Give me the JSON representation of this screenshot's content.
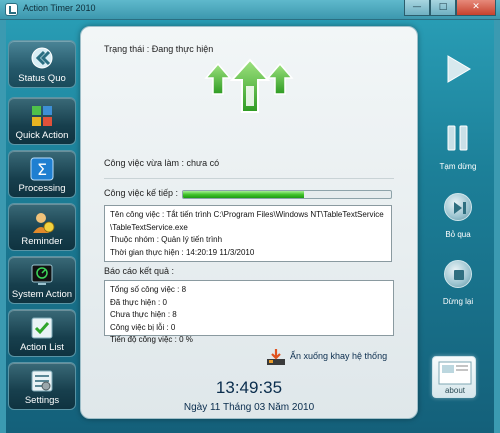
{
  "window": {
    "title": "Action Timer 2010",
    "minimize": "—",
    "maximize": "□",
    "close": "✕"
  },
  "sidebar": {
    "items": [
      {
        "label": "Status Quo",
        "icon": "status-quo-icon"
      },
      {
        "label": "Quick Action",
        "icon": "quick-action-icon"
      },
      {
        "label": "Processing",
        "icon": "processing-icon"
      },
      {
        "label": "Reminder",
        "icon": "reminder-icon"
      },
      {
        "label": "System Action",
        "icon": "system-action-icon"
      },
      {
        "label": "Action List",
        "icon": "action-list-icon"
      },
      {
        "label": "Settings",
        "icon": "settings-icon"
      }
    ]
  },
  "main": {
    "status_label": "Trạng thái : Đang thực hiện",
    "current_task_label": "Công việc vừa làm : chưa có",
    "next_task_label": "Công việc kế tiếp :",
    "progress_percent": 58,
    "next_task": {
      "line1": "Tên công việc : Tắt tiến trình C:\\Program Files\\Windows NT\\TableTextService",
      "line2": "\\TableTextService.exe",
      "line3": "Thuộc nhóm : Quản lý tiến trình",
      "line4": "Thời gian thực hiện : 14:20:19  11/3/2010"
    },
    "report_label": "Báo cáo kết quả :",
    "report": {
      "line1": "Tổng số công việc : 8",
      "line2": "Đã thực hiện : 0",
      "line3": "Chưa thực hiện : 8",
      "line4": "Công việc bị lỗi : 0",
      "line5": "Tiến độ công việc : 0  %"
    },
    "minimize_tray_label": "Ẩn xuống khay hệ thống",
    "clock": "13:49:35",
    "date": "Ngày 11 Tháng 03 Năm 2010"
  },
  "controls": {
    "pause_label": "Tạm dừng",
    "skip_label": "Bỏ qua",
    "stop_label": "Dừng lại",
    "thumbnail_caption": "about"
  },
  "colors": {
    "accent": "#1c7f98",
    "progress": "#41c32a",
    "arrows": "#3fae2a"
  }
}
